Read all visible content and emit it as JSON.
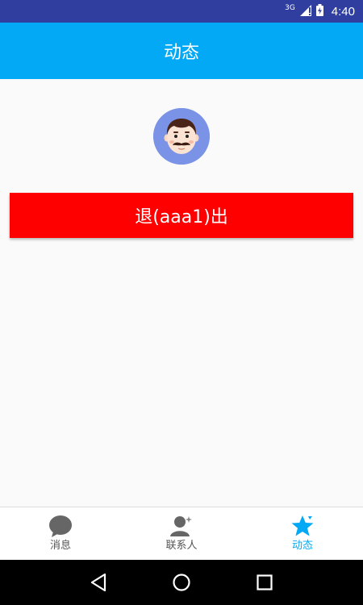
{
  "status_bar": {
    "network": "3G",
    "time": "4:40"
  },
  "app_bar": {
    "title": "动态"
  },
  "main": {
    "avatar_icon": "avatar-mustache-man",
    "logout_label": "退(aaa1)出"
  },
  "bottom_nav": {
    "items": [
      {
        "label": "消息",
        "icon": "chat-bubble-icon",
        "active": false
      },
      {
        "label": "联系人",
        "icon": "contacts-icon",
        "active": false
      },
      {
        "label": "动态",
        "icon": "star-icon",
        "active": true
      }
    ]
  },
  "system_nav": {
    "buttons": [
      "back-icon",
      "home-icon",
      "recents-icon"
    ]
  },
  "colors": {
    "status_bar": "#303f9f",
    "app_bar": "#03a9f4",
    "logout_button": "#ff0000",
    "active_tab": "#03a9f4",
    "inactive_tab": "#555555"
  }
}
